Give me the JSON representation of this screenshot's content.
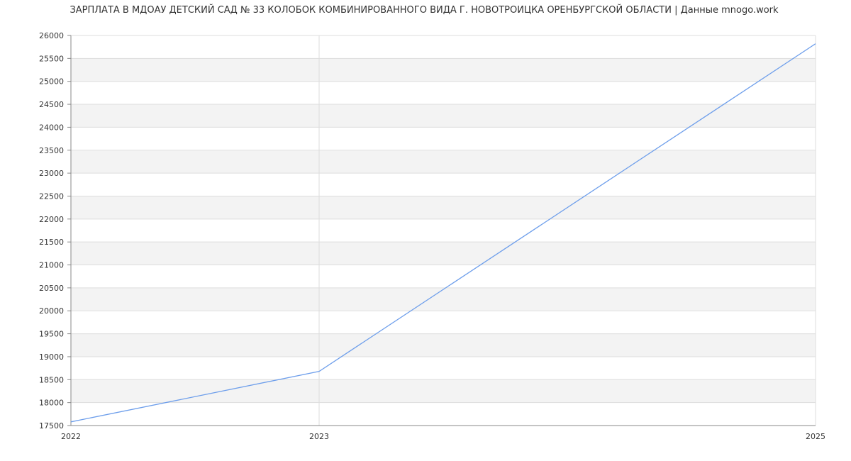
{
  "chart_data": {
    "type": "line",
    "title": "ЗАРПЛАТА В МДОАУ ДЕТСКИЙ САД № 33 КОЛОБОК КОМБИНИРОВАННОГО ВИДА Г. НОВОТРОИЦКА ОРЕНБУРГСКОЙ ОБЛАСТИ | Данные mnogo.work",
    "xlabel": "",
    "ylabel": "",
    "x_ticks": [
      "2022",
      "2023",
      "2025"
    ],
    "y_ticks": [
      "17500",
      "18000",
      "18500",
      "19000",
      "19500",
      "20000",
      "20500",
      "21000",
      "21500",
      "22000",
      "22500",
      "23000",
      "23500",
      "24000",
      "24500",
      "25000",
      "25500",
      "26000"
    ],
    "ylim": [
      17500,
      26000
    ],
    "grid": true,
    "legend": "none",
    "series": [
      {
        "color": "#6d9eeb",
        "points": [
          {
            "x": "2022",
            "y": 17580
          },
          {
            "x": "2023",
            "y": 18680
          },
          {
            "x": "2025",
            "y": 25820
          }
        ]
      }
    ],
    "colors": {
      "band_alt": "#f3f3f3",
      "grid": "#dddddd",
      "axis": "#888888",
      "text": "#333333"
    }
  }
}
